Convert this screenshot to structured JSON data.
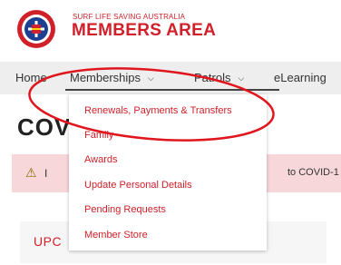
{
  "header": {
    "org_name": "SURF LIFE SAVING AUSTRALIA",
    "area_name": "MEMBERS AREA"
  },
  "nav": {
    "home": "Home",
    "memberships": "Memberships",
    "patrols": "Patrols",
    "elearning": "eLearning"
  },
  "dropdown": {
    "items": [
      "Renewals, Payments & Transfers",
      "Family",
      "Awards",
      "Update Personal Details",
      "Pending Requests",
      "Member Store"
    ]
  },
  "page": {
    "title_partial": "COV",
    "alert_left": "I",
    "alert_right": "to COVID-1",
    "card_partial": "UPC"
  },
  "colors": {
    "brand_red": "#d0202a",
    "nav_bg": "#eeeeee",
    "alert_bg": "#f8d7da",
    "annotation_red": "#e0161e"
  },
  "icons": [
    "surf-life-saving-logo-icon",
    "chevron-down-icon",
    "warning-icon"
  ]
}
